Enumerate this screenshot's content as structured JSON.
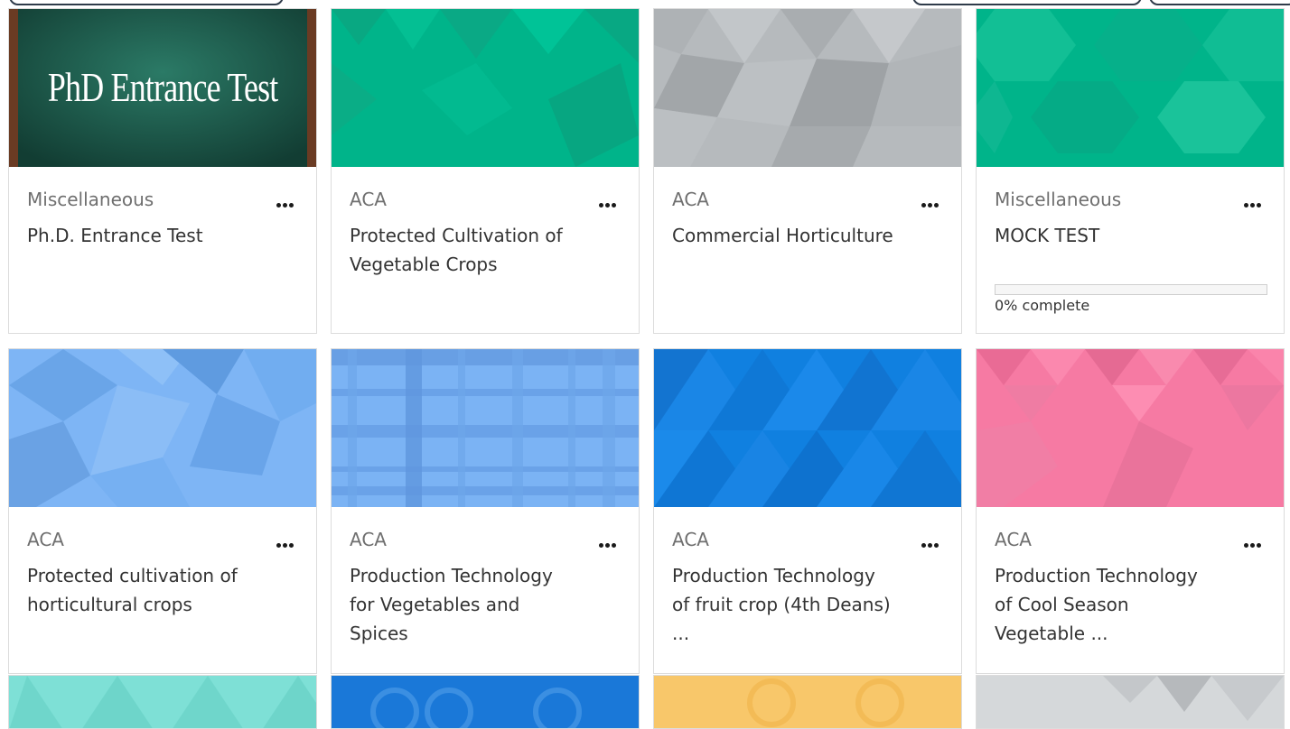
{
  "courses": [
    {
      "category": "Miscellaneous",
      "title": "Ph.D. Entrance Test",
      "thumb_text": "PhD Entrance Test"
    },
    {
      "category": "ACA",
      "title": "Protected Cultivation of Vegetable Crops"
    },
    {
      "category": "ACA",
      "title": "Commercial Horticulture"
    },
    {
      "category": "Miscellaneous",
      "title": "MOCK TEST",
      "progress": 0,
      "progress_label": "0% complete"
    },
    {
      "category": "ACA",
      "title": "Protected cultivation of horticultural crops"
    },
    {
      "category": "ACA",
      "title": "Production Technology for Vegetables and Spices"
    },
    {
      "category": "ACA",
      "title": "Production Technology of fruit crop (4th Deans) ..."
    },
    {
      "category": "ACA",
      "title": "Production Technology of Cool Season Vegetable ..."
    }
  ],
  "colors": {
    "teal": "#00b48a",
    "grey": "#b6babd",
    "light_blue": "#7eb5f5",
    "blue": "#1080e0",
    "pink": "#f67aa3",
    "chalk_green": "#1a5a4a",
    "cyan": "#7ee0d6",
    "yellow": "#f8c76a"
  }
}
